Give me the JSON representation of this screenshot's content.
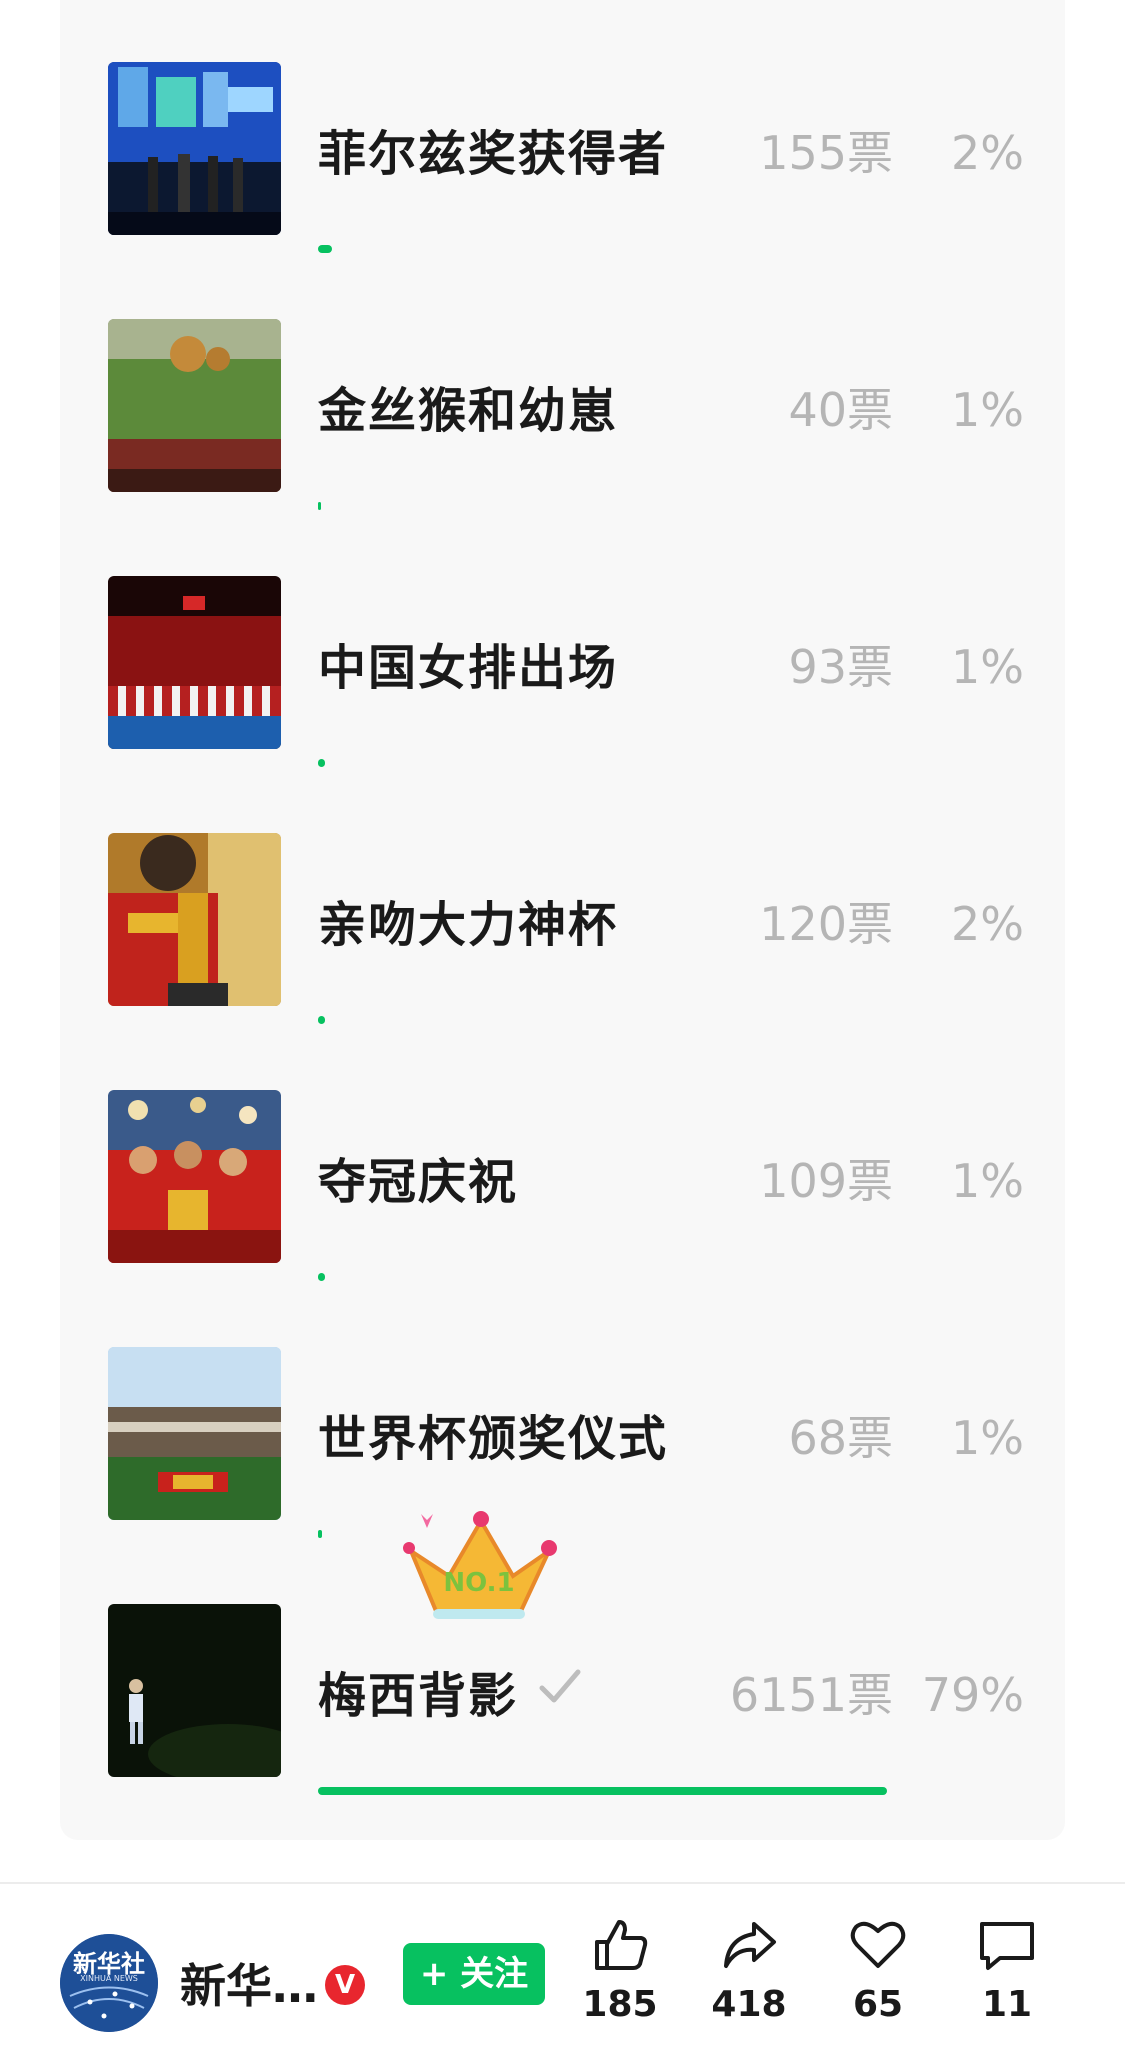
{
  "poll": {
    "options": [
      {
        "label": "菲尔兹奖获得者",
        "votes": "155票",
        "percent": "2%",
        "fraction": 0.02
      },
      {
        "label": "金丝猴和幼崽",
        "votes": "40票",
        "percent": "1%",
        "fraction": 0.003
      },
      {
        "label": "中国女排出场",
        "votes": "93票",
        "percent": "1%",
        "fraction": 0.01
      },
      {
        "label": "亲吻大力神杯",
        "votes": "120票",
        "percent": "2%",
        "fraction": 0.01
      },
      {
        "label": "夺冠庆祝",
        "votes": "109票",
        "percent": "1%",
        "fraction": 0.01
      },
      {
        "label": "世界杯颁奖仪式",
        "votes": "68票",
        "percent": "1%",
        "fraction": 0.005
      },
      {
        "label": "梅西背影",
        "votes": "6151票",
        "percent": "79%",
        "fraction": 0.79,
        "selected": true
      }
    ],
    "winner_badge": "NO.1",
    "accent_color": "#07c160"
  },
  "footer": {
    "account_name": "新华…",
    "verified_mark": "V",
    "follow_label": "+ 关注",
    "actions": [
      {
        "icon": "thumbs-up-icon",
        "count": "185"
      },
      {
        "icon": "share-icon",
        "count": "418"
      },
      {
        "icon": "heart-icon",
        "count": "65"
      },
      {
        "icon": "comment-icon",
        "count": "11"
      }
    ]
  }
}
